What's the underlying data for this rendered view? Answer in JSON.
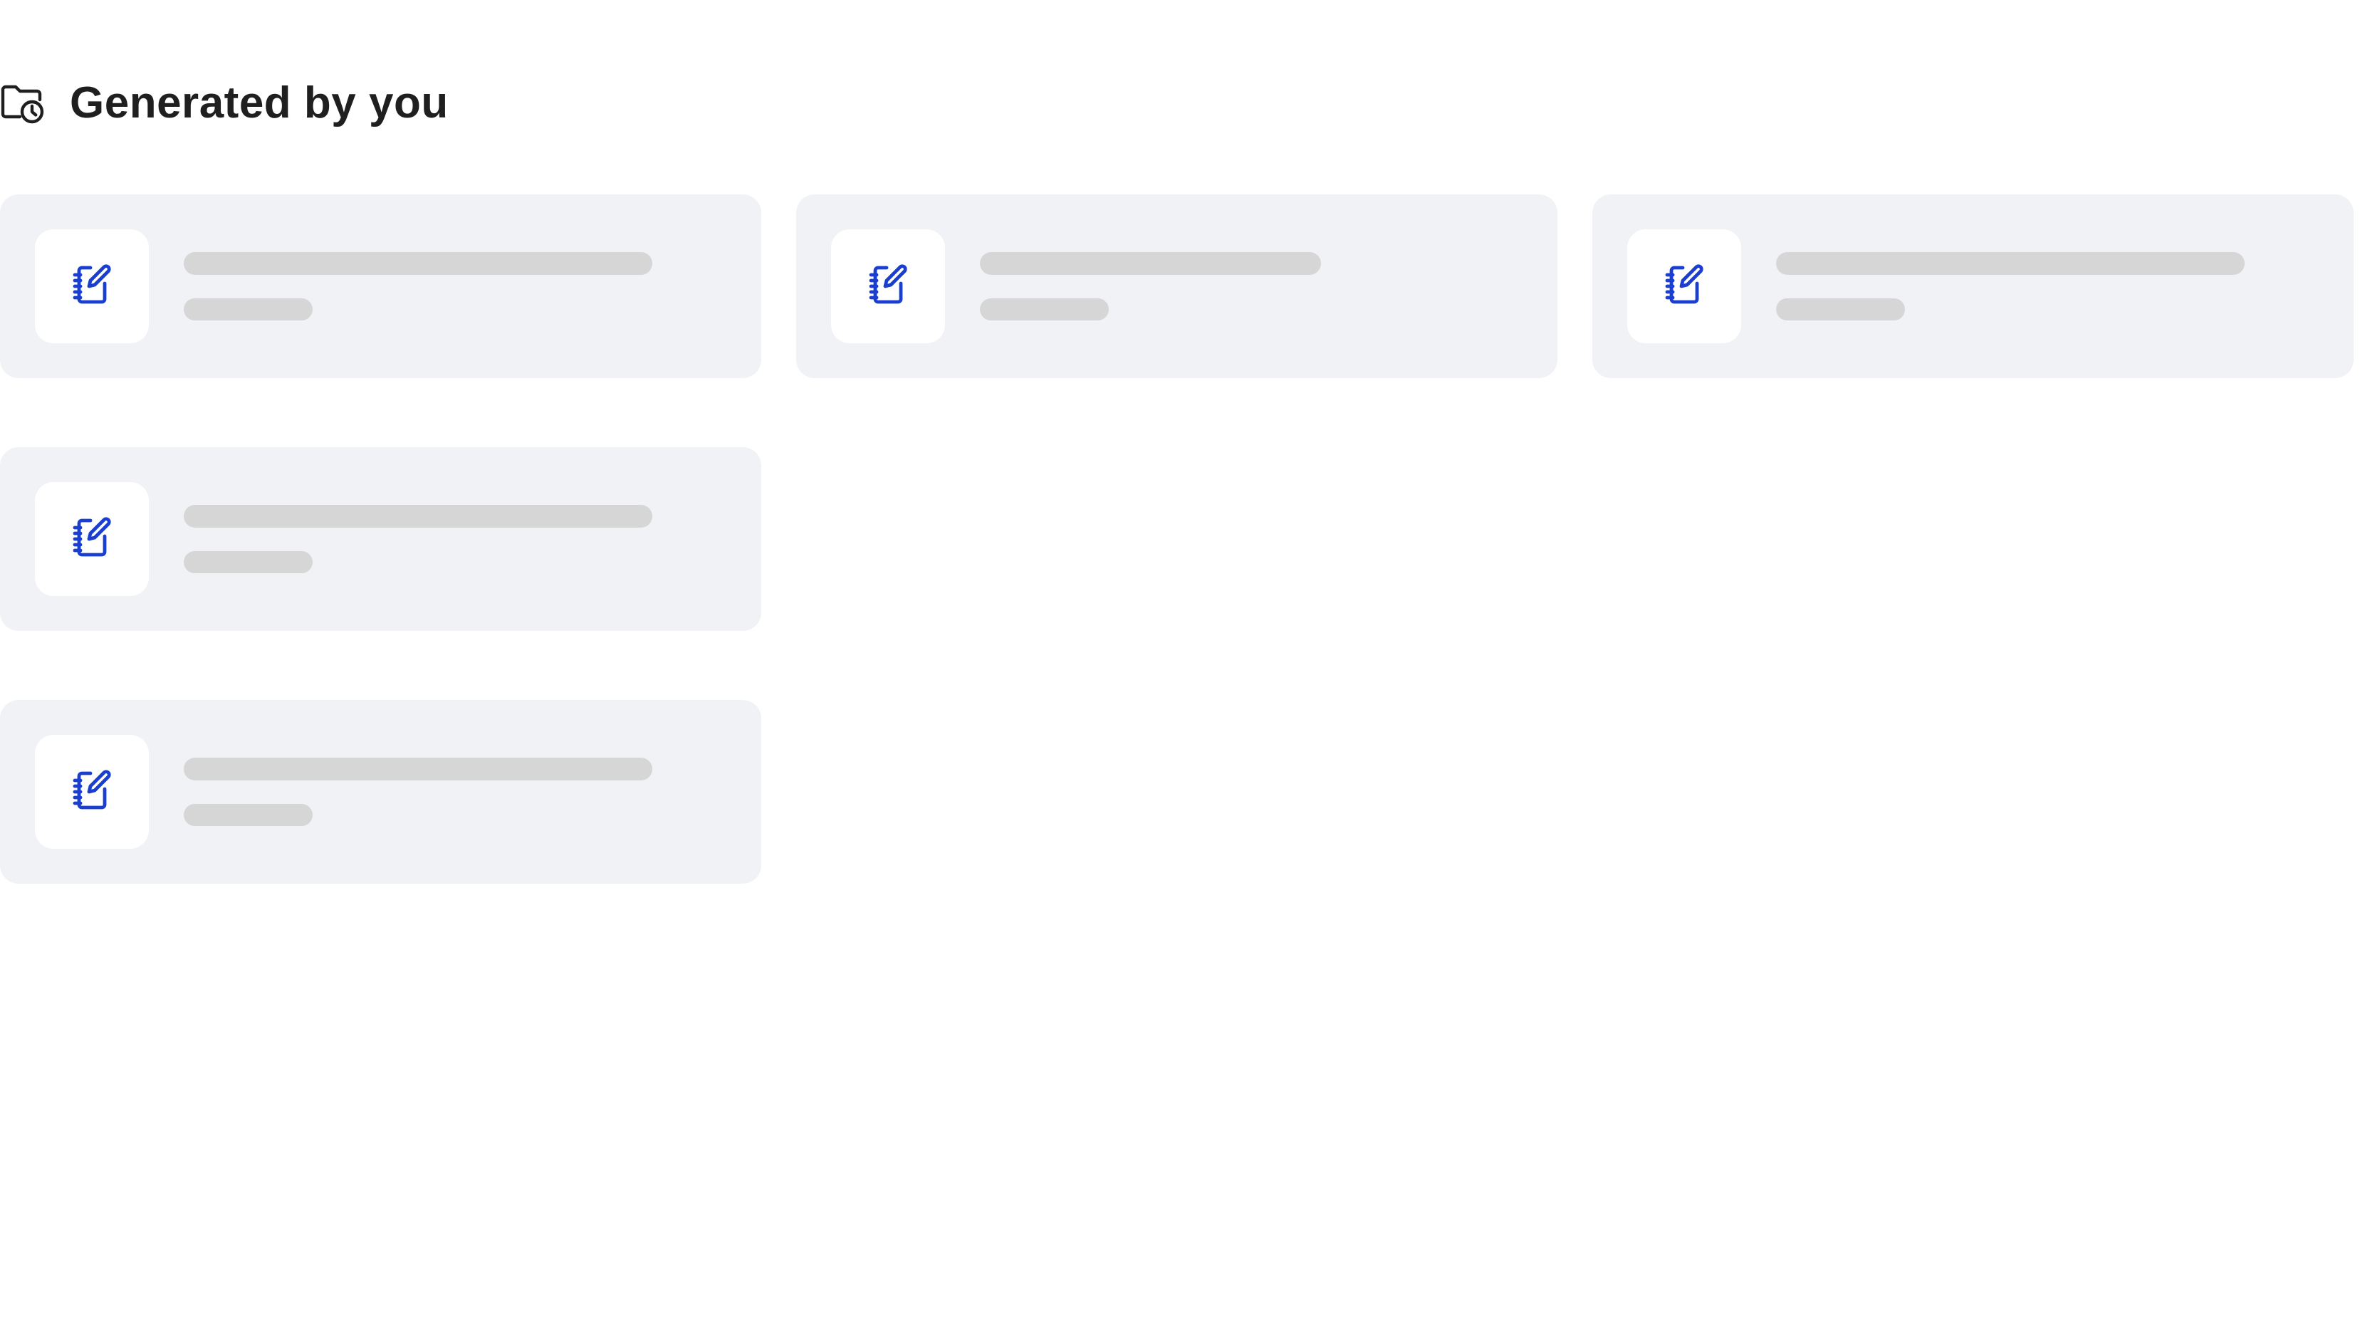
{
  "header": {
    "title": "Generated by you",
    "icon": "folder-clock-icon"
  },
  "colors": {
    "accent": "#1a3fd0",
    "card_background": "#f1f2f5",
    "skeleton": "#d6d6d6",
    "title_text": "#1f1f1f"
  },
  "cards": [
    {
      "icon": "notebook-edit-icon",
      "state": "loading"
    },
    {
      "icon": "notebook-edit-icon",
      "state": "loading"
    },
    {
      "icon": "notebook-edit-icon",
      "state": "loading"
    },
    {
      "icon": "notebook-edit-icon",
      "state": "loading"
    },
    {
      "icon": "notebook-edit-icon",
      "state": "loading"
    }
  ]
}
